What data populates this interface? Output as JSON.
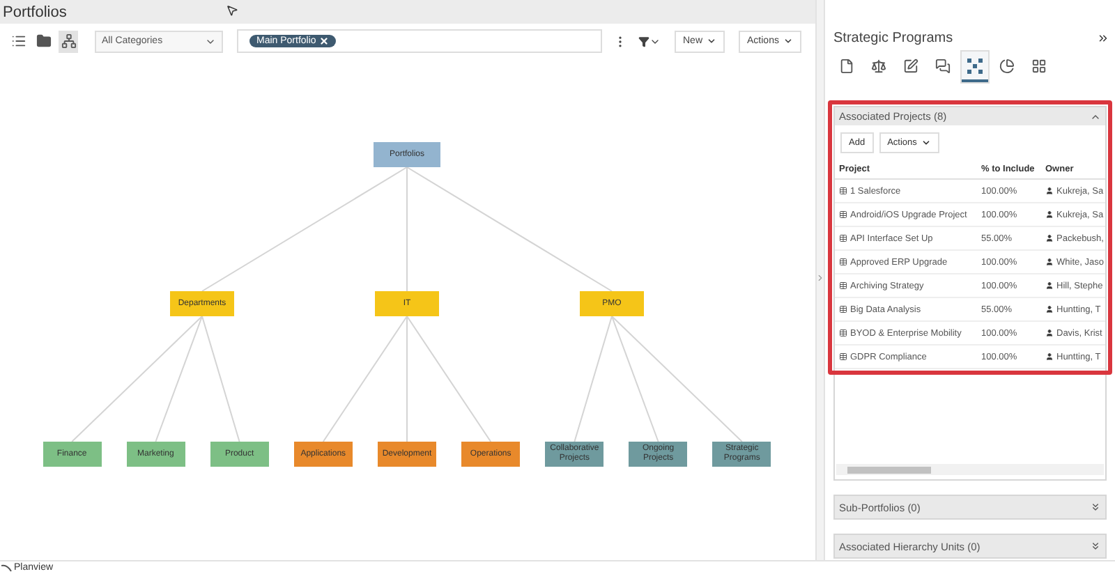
{
  "page": {
    "title": "Portfolios"
  },
  "toolbar": {
    "views": [
      {
        "kind": "list",
        "selected": false
      },
      {
        "kind": "folder",
        "selected": false
      },
      {
        "kind": "hierarchy",
        "selected": true
      }
    ],
    "category": "All Categories",
    "chips": [
      "Main Portfolio"
    ],
    "buttons": [
      "New",
      "Actions"
    ]
  },
  "tree": {
    "label": "Portfolios",
    "color": "#93b4cf",
    "children": [
      {
        "label": "Departments",
        "color": "#f5c518",
        "children": [
          {
            "label": "Finance",
            "color": "#7dbf85"
          },
          {
            "label": "Marketing",
            "color": "#7dbf85"
          },
          {
            "label": "Product",
            "color": "#7dbf85"
          }
        ]
      },
      {
        "label": "IT",
        "color": "#f5c518",
        "children": [
          {
            "label": "Applications",
            "color": "#e8892b"
          },
          {
            "label": "Development",
            "color": "#e8892b"
          },
          {
            "label": "Operations",
            "color": "#e8892b"
          }
        ]
      },
      {
        "label": "PMO",
        "color": "#f5c518",
        "children": [
          {
            "label": "Collaborative Projects",
            "color": "#6f9a9e"
          },
          {
            "label": "Ongoing Projects",
            "color": "#6f9a9e"
          },
          {
            "label": "Strategic Programs",
            "color": "#6f9a9e"
          }
        ]
      }
    ]
  },
  "panel": {
    "title": "Strategic Programs",
    "tabs": [
      {
        "kind": "document",
        "selected": false
      },
      {
        "kind": "scale",
        "selected": false
      },
      {
        "kind": "edit",
        "selected": false
      },
      {
        "kind": "comments",
        "selected": false
      },
      {
        "kind": "nodes",
        "selected": true
      },
      {
        "kind": "pie",
        "selected": false
      },
      {
        "kind": "grid",
        "selected": false
      }
    ],
    "sections": [
      {
        "title": "Associated Projects (8)",
        "expanded": true,
        "highlighted": true,
        "buttons": [
          "Add",
          "Actions"
        ],
        "columns": [
          "Project",
          "% to Include",
          "Owner"
        ],
        "rows": [
          [
            "1 Salesforce",
            "100.00%",
            "Kukreja, Sa"
          ],
          [
            "Android/iOS Upgrade Project",
            "100.00%",
            "Kukreja, Sa"
          ],
          [
            "API Interface Set Up",
            "55.00%",
            "Packebush,"
          ],
          [
            "Approved ERP Upgrade",
            "100.00%",
            "White, Jaso"
          ],
          [
            "Archiving Strategy",
            "100.00%",
            "Hill, Stephe"
          ],
          [
            "Big Data Analysis",
            "55.00%",
            "Huntting, T"
          ],
          [
            "BYOD & Enterprise Mobility",
            "100.00%",
            "Davis, Krist"
          ],
          [
            "GDPR Compliance",
            "100.00%",
            "Huntting, T"
          ]
        ]
      },
      {
        "title": "Sub-Portfolios (0)",
        "expanded": false,
        "highlighted": false
      },
      {
        "title": "Associated Hierarchy Units (0)",
        "expanded": false,
        "highlighted": false
      }
    ]
  },
  "footer": {
    "brand": "Planview"
  }
}
